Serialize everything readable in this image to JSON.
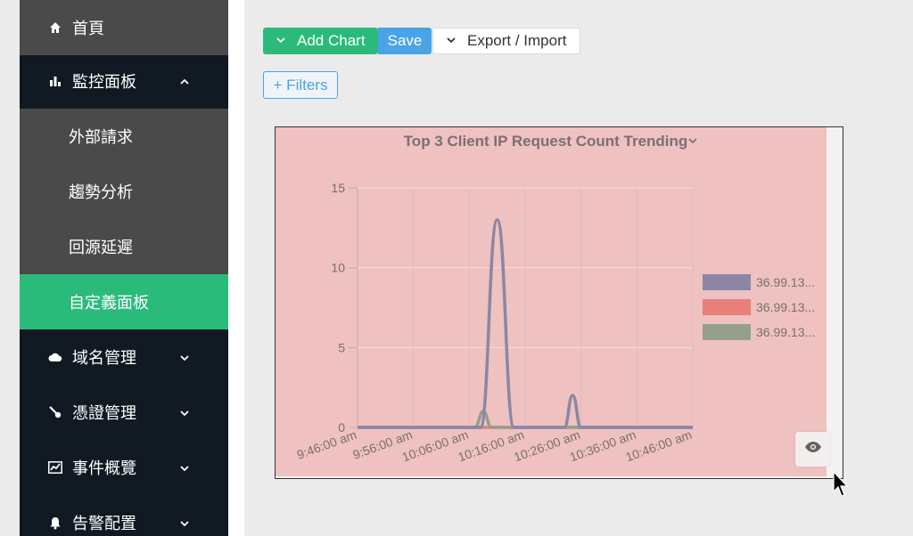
{
  "sidebar": {
    "items": [
      {
        "label": "首頁",
        "icon": "home-icon"
      },
      {
        "label": "監控面板",
        "icon": "bar-chart-icon",
        "chevron": "up"
      },
      {
        "label": "外部請求"
      },
      {
        "label": "趨勢分析"
      },
      {
        "label": "回源延遲"
      },
      {
        "label": "自定義面板",
        "active": true
      },
      {
        "label": "域名管理",
        "icon": "cloud-icon",
        "chevron": "down"
      },
      {
        "label": "憑證管理",
        "icon": "key-icon",
        "chevron": "down"
      },
      {
        "label": "事件概覽",
        "icon": "trend-icon",
        "chevron": "down"
      },
      {
        "label": "告警配置",
        "icon": "bell-icon",
        "chevron": "down"
      }
    ]
  },
  "toolbar": {
    "add_chart_label": "Add Chart",
    "save_label": "Save",
    "export_label": "Export / Import",
    "filters_label": "+ Filters"
  },
  "colors": {
    "sidebar_bg": "#111a22",
    "active_green": "#2abb7b",
    "save_blue": "#4aa3e6",
    "chart_bg": "#efc1c0",
    "series_1": "#8b86a6",
    "series_2": "#e88079",
    "series_3": "#94a08a"
  },
  "chart_data": {
    "type": "line",
    "title": "Top 3 Client IP Request Count Trending",
    "x_ticks": [
      "9:46:00 am",
      "9:56:00 am",
      "10:06:00 am",
      "10:16:00 am",
      "10:26:00 am",
      "10:36:00 am",
      "10:46:00 am"
    ],
    "ylim": [
      0,
      15
    ],
    "y_ticks": [
      0,
      5,
      10,
      15
    ],
    "grid": true,
    "legend_position": "right",
    "series": [
      {
        "name": "36.99.13...",
        "color": "#8b86a6",
        "points": [
          [
            "9:46",
            0
          ],
          [
            "10:08",
            0
          ],
          [
            "10:11",
            13
          ],
          [
            "10:14",
            0
          ],
          [
            "10:23",
            0
          ],
          [
            "10:24:30",
            2
          ],
          [
            "10:26",
            0
          ],
          [
            "10:46",
            0
          ]
        ]
      },
      {
        "name": "36.99.13...",
        "color": "#e88079",
        "points": [
          [
            "9:46",
            0
          ],
          [
            "10:46",
            0
          ]
        ]
      },
      {
        "name": "36.99.13...",
        "color": "#94a08a",
        "points": [
          [
            "9:46",
            0
          ],
          [
            "10:07",
            0
          ],
          [
            "10:08:30",
            1
          ],
          [
            "10:10",
            0
          ],
          [
            "10:46",
            0
          ]
        ]
      }
    ]
  }
}
